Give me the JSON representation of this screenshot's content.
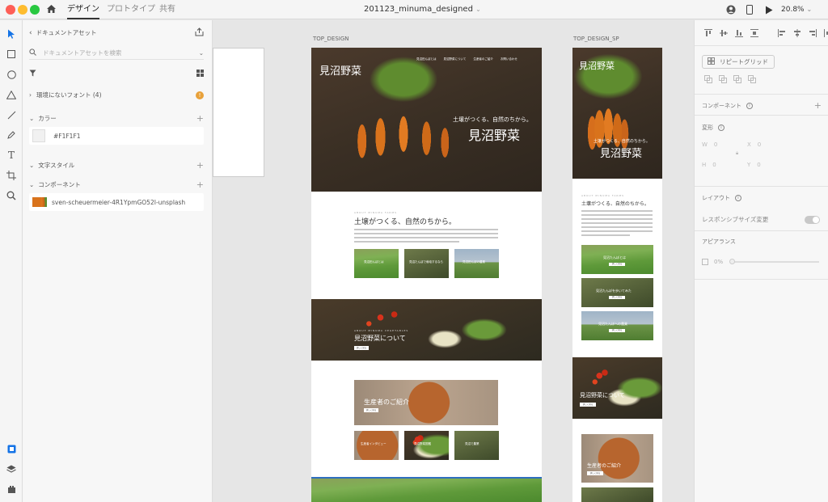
{
  "titlebar": {
    "tabs": [
      "デザイン",
      "プロトタイプ",
      "共有"
    ],
    "document_title": "201123_minuma_designed",
    "zoom": "20.8%",
    "traffic_colors": [
      "#fe5f57",
      "#febc2e",
      "#28c840"
    ]
  },
  "assets": {
    "back_label": "ドキュメントアセット",
    "search_placeholder": "ドキュメントアセットを検索",
    "missing_fonts": "環境にないフォント (4)",
    "colors_label": "カラー",
    "color_value": "#F1F1F1",
    "text_styles_label": "文字スタイル",
    "components_label": "コンポーネント",
    "component_name": "sven-scheuermeier-4R1YpmGO52I-unsplash"
  },
  "canvas": {
    "artboard_desktop": "TOP_DESIGN",
    "artboard_sp": "TOP_DESIGN_SP",
    "brand": "見沼野菜",
    "hero_tagline": "土壌がつくる、自然のちから。",
    "about_heading": "土壌がつくる、自然のちから。",
    "about_sub": "ABOUT MINUMA FARMS",
    "nav_items": [
      "見沼田んぼとは",
      "見沼野菜について",
      "生産者のご紹介",
      "お問い合わせ"
    ],
    "about_cards": [
      "見沼田んぼとは",
      "見沼たんぼで栽培するなら",
      "見沼田んぼの農業"
    ],
    "veg_section_sub": "ABOUT MINUMA VEGETABLES",
    "veg_section_title": "見沼野菜について",
    "producer_title": "生産者のご紹介",
    "producer_cards": [
      "生産者インタビュー",
      "見沼野菜図鑑",
      "見沼で農業"
    ],
    "sp_cards": [
      "見沼たんぼとは",
      "見沼たんぼを歩いてみた",
      "見沼たんぼへの農業"
    ],
    "sp_veg_title": "見沼野菜について",
    "sp_producer_title": "生産者のご紹介",
    "button_label": "詳しく見る"
  },
  "props": {
    "repeat_grid": "リピートグリッド",
    "component_label": "コンポーネント",
    "transform_label": "変形",
    "w_label": "W",
    "w_value": "0",
    "x_label": "X",
    "x_value": "0",
    "h_label": "H",
    "h_value": "0",
    "y_label": "Y",
    "y_value": "0",
    "layout_label": "レイアウト",
    "responsive_label": "レスポンシブサイズ変更",
    "appearance_label": "アピアランス",
    "opacity": "0%"
  }
}
